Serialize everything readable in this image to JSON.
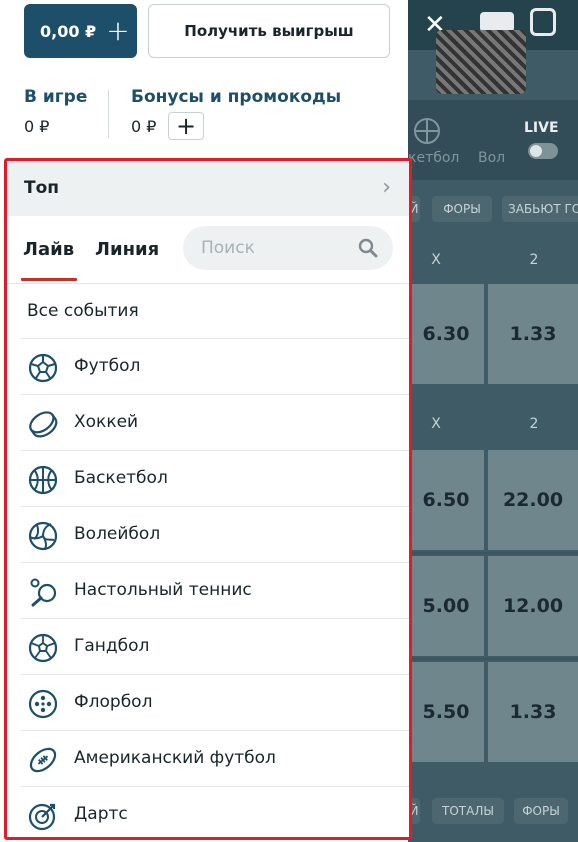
{
  "header": {
    "balance_label": "0,00 ₽",
    "balance_plus": "+",
    "withdraw_label": "Получить выигрыш"
  },
  "stats": {
    "in_game_label": "В игре",
    "in_game_value": "0 ₽",
    "bonus_label": "Бонусы и промокоды",
    "bonus_value": "0 ₽",
    "bonus_plus": "+"
  },
  "menu": {
    "top_label": "Топ",
    "tabs": [
      {
        "label": "Лайв"
      },
      {
        "label": "Линия"
      }
    ],
    "active_tab": "Лайв",
    "search_placeholder": "Поиск",
    "all_events_label": "Все события",
    "items": [
      {
        "label": "Футбол",
        "icon": "soccer-ball-icon"
      },
      {
        "label": "Хоккей",
        "icon": "hockey-puck-icon"
      },
      {
        "label": "Баскетбол",
        "icon": "basketball-icon"
      },
      {
        "label": "Волейбол",
        "icon": "volleyball-icon"
      },
      {
        "label": "Настольный теннис",
        "icon": "table-tennis-icon"
      },
      {
        "label": "Гандбол",
        "icon": "handball-icon"
      },
      {
        "label": "Флорбол",
        "icon": "floorball-icon"
      },
      {
        "label": "Американский футбол",
        "icon": "american-football-icon"
      },
      {
        "label": "Дартс",
        "icon": "darts-icon"
      }
    ]
  },
  "background": {
    "sport_labels": [
      "кетбол",
      "Вол"
    ],
    "live_label": "LIVE",
    "filters_top": [
      "Й",
      "ФОРЫ",
      "ЗАБЬЮТ ГО"
    ],
    "filters_bottom": [
      "Й",
      "ТОТАЛЫ",
      "ФОРЫ"
    ],
    "col_x": "X",
    "col_2": "2",
    "odds": [
      {
        "x": "6.30",
        "two": "1.33"
      },
      {
        "x": "6.50",
        "two": "22.00"
      },
      {
        "x": "5.00",
        "two": "12.00"
      },
      {
        "x": "5.50",
        "two": "1.33"
      }
    ]
  },
  "colors": {
    "brand_blue": "#1e4f6a",
    "highlight_red": "#e21b2a",
    "tab_underline": "#c4302b",
    "overlay": "#3f5b65"
  }
}
